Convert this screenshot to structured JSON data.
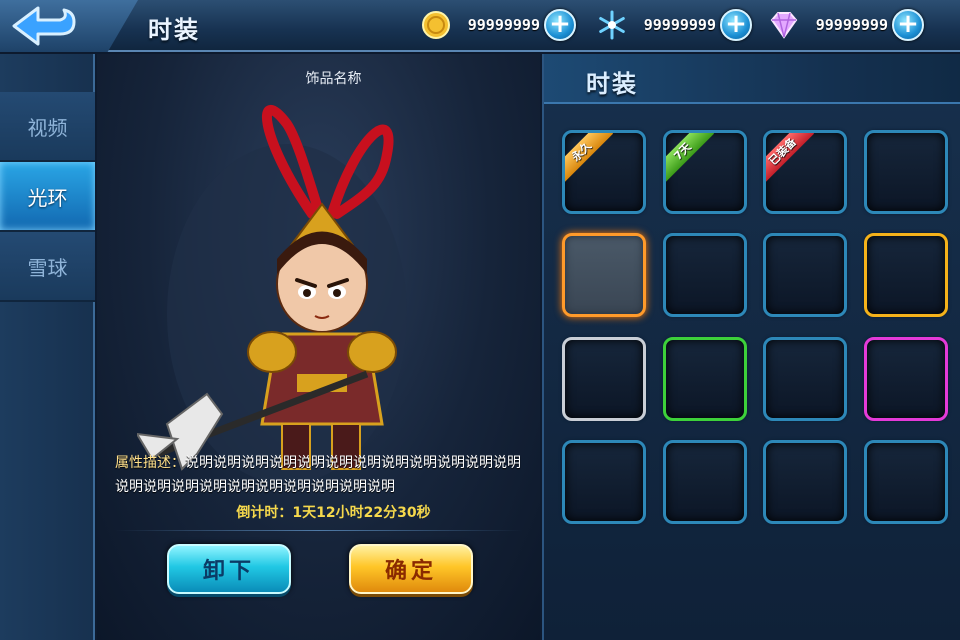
{
  "header": {
    "title": "时装",
    "currencies": [
      {
        "icon": "gold-coin-icon",
        "value": "99999999"
      },
      {
        "icon": "snowflake-icon",
        "value": "99999999"
      },
      {
        "icon": "diamond-icon",
        "value": "99999999"
      }
    ],
    "plus_label": "+"
  },
  "sidebar": {
    "tabs": [
      {
        "label": "视频",
        "active": false
      },
      {
        "label": "光环",
        "active": true
      },
      {
        "label": "雪球",
        "active": false
      }
    ]
  },
  "preview": {
    "item_name": "饰品名称",
    "desc_label": "属性描述：",
    "desc_text": "说明说明说明说明说明说明说明说明说明说明说明说明说明说明说明说明说明说明说明说明说明说明",
    "countdown_label": "倒计时：",
    "countdown_value": "1天12小时22分30秒",
    "unequip_label": "卸下",
    "confirm_label": "确定"
  },
  "panel": {
    "title": "时装",
    "slots": [
      {
        "border": "cyan",
        "tag": "永久",
        "tag_color": "orange"
      },
      {
        "border": "cyan",
        "tag": "7天",
        "tag_color": "green"
      },
      {
        "border": "cyan",
        "tag": "已装备",
        "tag_color": "red"
      },
      {
        "border": "cyan",
        "tag": ""
      },
      {
        "border": "selected",
        "tag": ""
      },
      {
        "border": "cyan",
        "tag": ""
      },
      {
        "border": "cyan",
        "tag": ""
      },
      {
        "border": "gold",
        "tag": ""
      },
      {
        "border": "white",
        "tag": ""
      },
      {
        "border": "green",
        "tag": ""
      },
      {
        "border": "cyan",
        "tag": ""
      },
      {
        "border": "purple",
        "tag": ""
      },
      {
        "border": "cyan",
        "tag": ""
      },
      {
        "border": "cyan",
        "tag": ""
      },
      {
        "border": "cyan",
        "tag": ""
      },
      {
        "border": "cyan",
        "tag": ""
      }
    ]
  }
}
